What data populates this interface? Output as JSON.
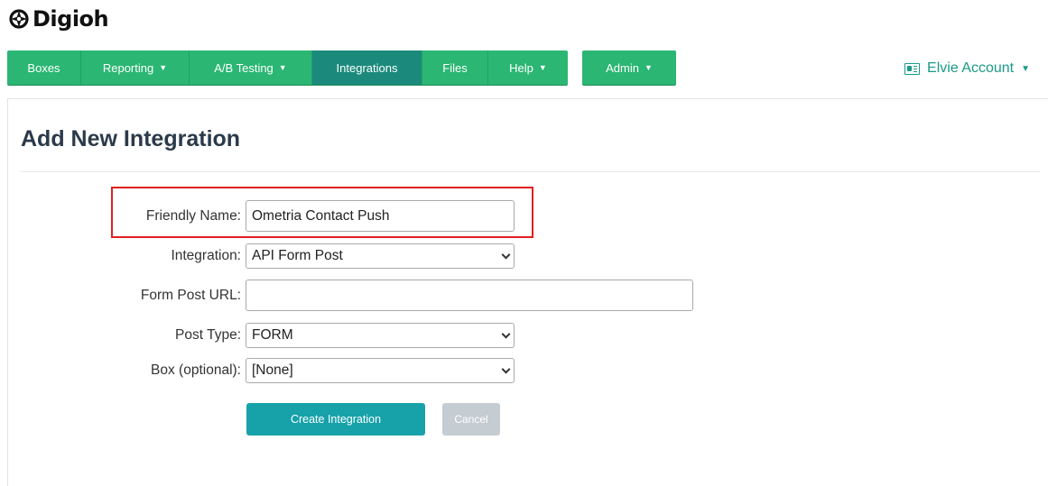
{
  "brand": {
    "name": "Digioh",
    "accent": "#2bb673",
    "active": "#1b8a7c",
    "link": "#1a9a86"
  },
  "nav": {
    "items": [
      {
        "label": "Boxes",
        "caret": false
      },
      {
        "label": "Reporting",
        "caret": true
      },
      {
        "label": "A/B Testing",
        "caret": true
      },
      {
        "label": "Integrations",
        "caret": false,
        "active": true
      },
      {
        "label": "Files",
        "caret": false
      },
      {
        "label": "Help",
        "caret": true
      }
    ],
    "admin_label": "Admin",
    "account_label": "Elvie Account"
  },
  "page": {
    "title": "Add New Integration"
  },
  "form": {
    "friendly_name": {
      "label": "Friendly Name:",
      "value": "Ometria Contact Push"
    },
    "integration": {
      "label": "Integration:",
      "value": "API Form Post"
    },
    "form_post_url": {
      "label": "Form Post URL:",
      "value": ""
    },
    "post_type": {
      "label": "Post Type:",
      "value": "FORM"
    },
    "box": {
      "label": "Box (optional):",
      "value": "[None]"
    },
    "create_label": "Create Integration",
    "cancel_label": "Cancel"
  }
}
